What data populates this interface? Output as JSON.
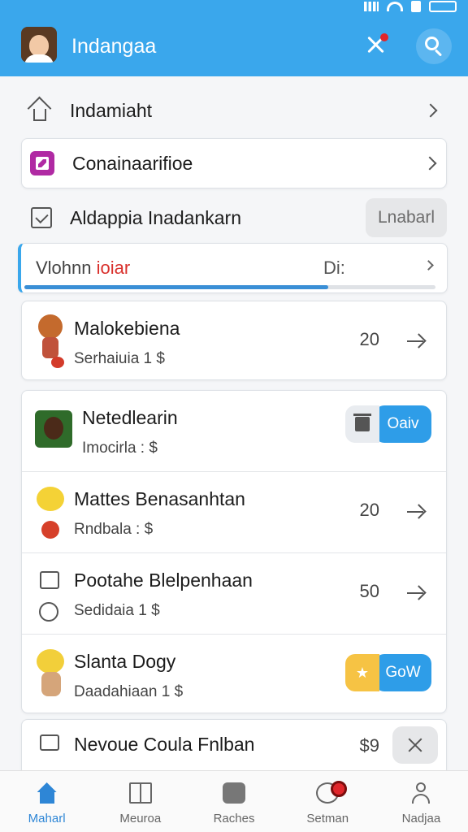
{
  "header": {
    "title": "Indangaa"
  },
  "menu": [
    {
      "label": "Indamiaht"
    },
    {
      "label": "Conainaarifioe"
    }
  ],
  "action_row": {
    "label": "Aldappia Inadankarn",
    "button": "Lnabarl"
  },
  "progress": {
    "label_left": "Vlohnn",
    "label_accent": "ioiar",
    "label_right": "Di:",
    "value": 0.74
  },
  "items_top": [
    {
      "title": "Malokebiena",
      "subtitle": "Serhaiuia 1 $",
      "value": "20"
    }
  ],
  "items": [
    {
      "title": "Netedlearin",
      "subtitle": "Imocirla : $",
      "pill": "Oaiv"
    },
    {
      "title": "Mattes Benasanhtan",
      "subtitle": "Rndbala : $",
      "value": "20"
    },
    {
      "title": "Pootahe Blelpenhaan",
      "subtitle": "Sedidaia 1 $",
      "value": "50"
    },
    {
      "title": "Slanta Dogy",
      "subtitle": "Daadahiaan 1 $",
      "pill": "GoW",
      "pill_icon": "★"
    }
  ],
  "last_item": {
    "title": "Nevoue Coula Fnlban",
    "value": "$9"
  },
  "nav": [
    {
      "label": "Maharl"
    },
    {
      "label": "Meuroa"
    },
    {
      "label": "Raches"
    },
    {
      "label": "Setman"
    },
    {
      "label": "Nadjaa"
    }
  ],
  "colors": {
    "primary": "#3aa7ec",
    "accent_red": "#d9302c",
    "nav_active": "#2e86d6"
  }
}
